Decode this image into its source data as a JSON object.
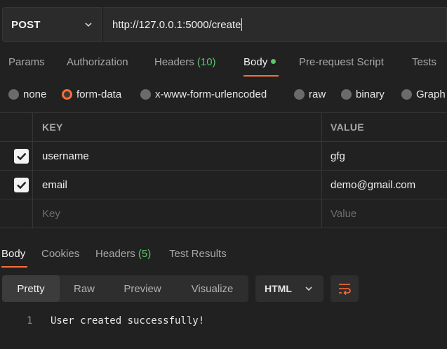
{
  "request": {
    "method": "POST",
    "url": "http://127.0.0.1:5000/create"
  },
  "request_tabs": [
    {
      "label": "Params",
      "count": ""
    },
    {
      "label": "Authorization",
      "count": ""
    },
    {
      "label": "Headers",
      "count": "(10)"
    },
    {
      "label": "Body",
      "count": ""
    },
    {
      "label": "Pre-request Script",
      "count": ""
    },
    {
      "label": "Tests",
      "count": ""
    }
  ],
  "body_types": [
    "none",
    "form-data",
    "x-www-form-urlencoded",
    "raw",
    "binary",
    "Graph"
  ],
  "selected_body_type": "form-data",
  "form_table": {
    "headers": {
      "key": "KEY",
      "value": "VALUE"
    },
    "rows": [
      {
        "checked": true,
        "key": "username",
        "value": "gfg"
      },
      {
        "checked": true,
        "key": "email",
        "value": "demo@gmail.com"
      }
    ],
    "placeholder": {
      "key": "Key",
      "value": "Value"
    }
  },
  "response_tabs": [
    {
      "label": "Body",
      "count": ""
    },
    {
      "label": "Cookies",
      "count": ""
    },
    {
      "label": "Headers",
      "count": "(5)"
    },
    {
      "label": "Test Results",
      "count": ""
    }
  ],
  "view_modes": [
    "Pretty",
    "Raw",
    "Preview",
    "Visualize"
  ],
  "format": "HTML",
  "response": {
    "line_number": "1",
    "text": "User created successfully!"
  },
  "colors": {
    "accent": "#ff6c37",
    "count_green": "#5ec46b",
    "background": "#212121"
  },
  "icons": [
    "chevron-down-icon",
    "check-icon",
    "wrap-lines-icon"
  ]
}
